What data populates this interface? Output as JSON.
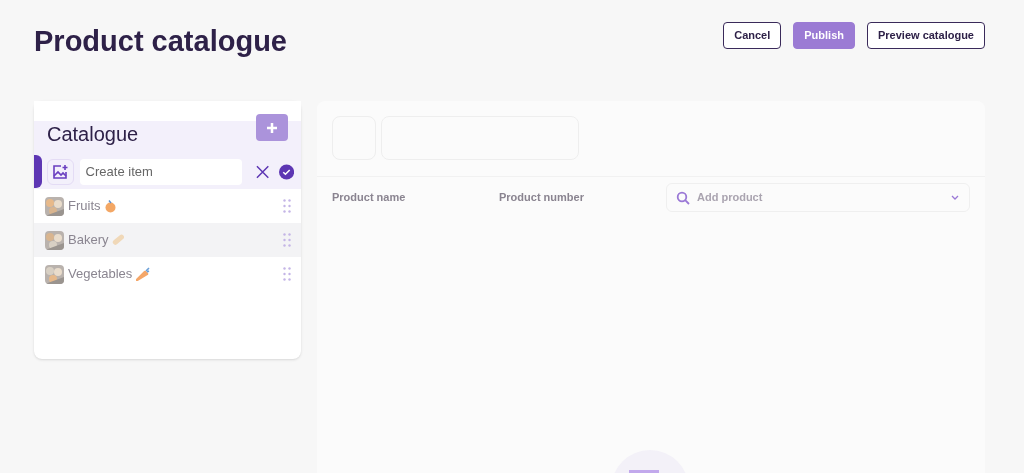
{
  "page_title": "Product catalogue",
  "actions": [
    {
      "label": "Cancel",
      "kind": "outline"
    },
    {
      "label": "Publish",
      "kind": "primary"
    },
    {
      "label": "Preview catalogue",
      "kind": "outline"
    }
  ],
  "catalogue": {
    "title": "Catalogue",
    "new_item": {
      "placeholder": "Create item"
    },
    "items": [
      {
        "label": "Fruits",
        "kind": "fruit",
        "highlighted": false
      },
      {
        "label": "Bakery",
        "kind": "bread",
        "highlighted": true
      },
      {
        "label": "Vegetables",
        "kind": "carrot",
        "highlighted": false
      }
    ]
  },
  "products": {
    "columns": [
      "Product name",
      "Product number"
    ],
    "search": {
      "placeholder": "Add product"
    }
  }
}
